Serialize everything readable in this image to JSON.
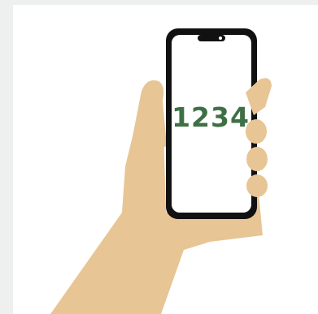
{
  "illustration": {
    "icon": "hand-holding-phone-icon",
    "screen_code": "1234"
  },
  "colors": {
    "page_background": "#eef0ef",
    "panel_background": "#ffffff",
    "skin": "#e8c594",
    "phone_frame": "#111111",
    "phone_screen": "#ffffff",
    "code_text": "#3e6f45"
  }
}
